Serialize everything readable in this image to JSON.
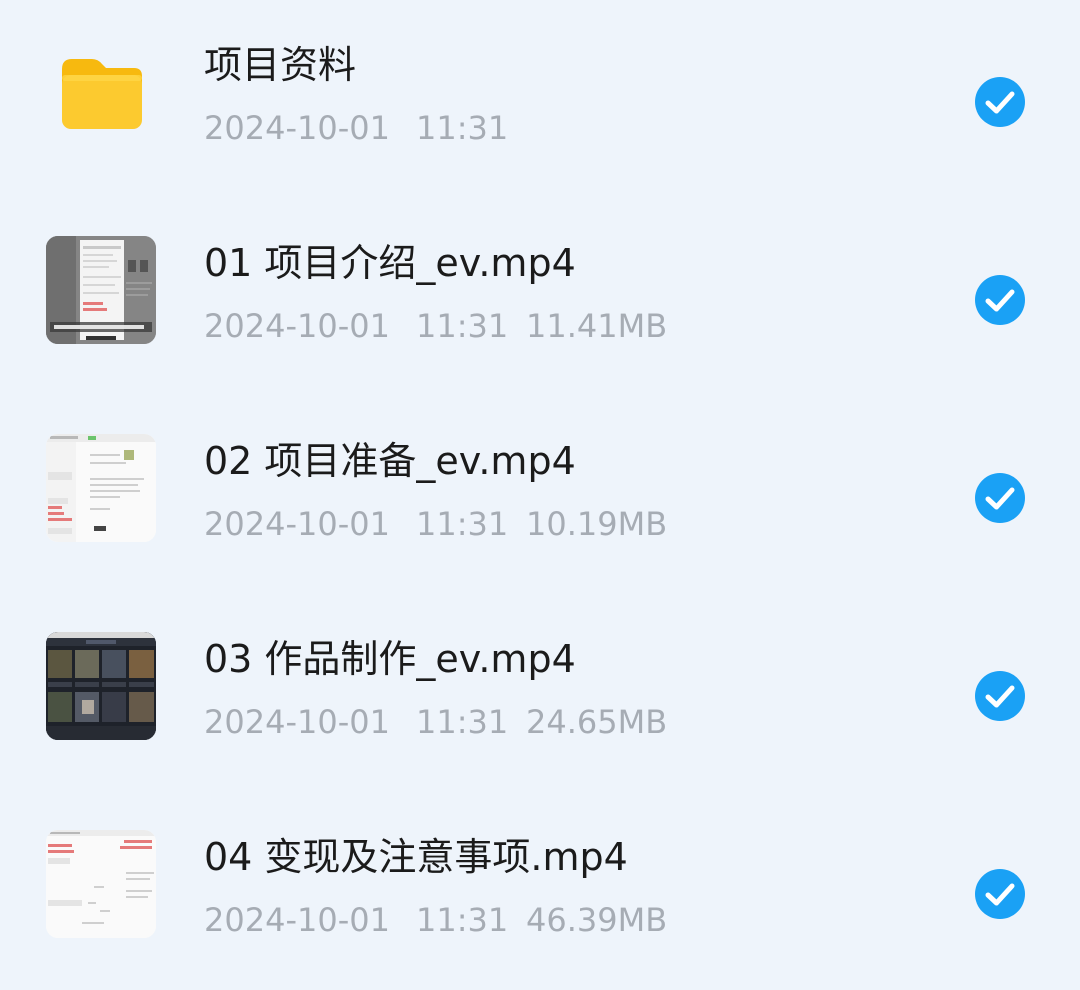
{
  "files": [
    {
      "name": "项目资料",
      "date": "2024-10-01",
      "time": "11:31",
      "size": "",
      "type": "folder",
      "selected": true
    },
    {
      "name": "01 项目介绍_ev.mp4",
      "date": "2024-10-01",
      "time": "11:31",
      "size": "11.41MB",
      "type": "video",
      "thumb_style": "gray-screen",
      "selected": true
    },
    {
      "name": "02 项目准备_ev.mp4",
      "date": "2024-10-01",
      "time": "11:31",
      "size": "10.19MB",
      "type": "video",
      "thumb_style": "white-doc",
      "selected": true
    },
    {
      "name": "03 作品制作_ev.mp4",
      "date": "2024-10-01",
      "time": "11:31",
      "size": "24.65MB",
      "type": "video",
      "thumb_style": "dark-grid",
      "selected": true
    },
    {
      "name": "04 变现及注意事项.mp4",
      "date": "2024-10-01",
      "time": "11:31",
      "size": "46.39MB",
      "type": "video",
      "thumb_style": "white-mindmap",
      "selected": true
    }
  ],
  "colors": {
    "background": "#eef4fb",
    "check": "#1aa1f5",
    "folder": "#fcca2f",
    "title_text": "#1b1b1b",
    "meta_text": "#a6acb4"
  },
  "icons": {
    "folder": "folder-icon",
    "check": "check-circle-icon"
  }
}
